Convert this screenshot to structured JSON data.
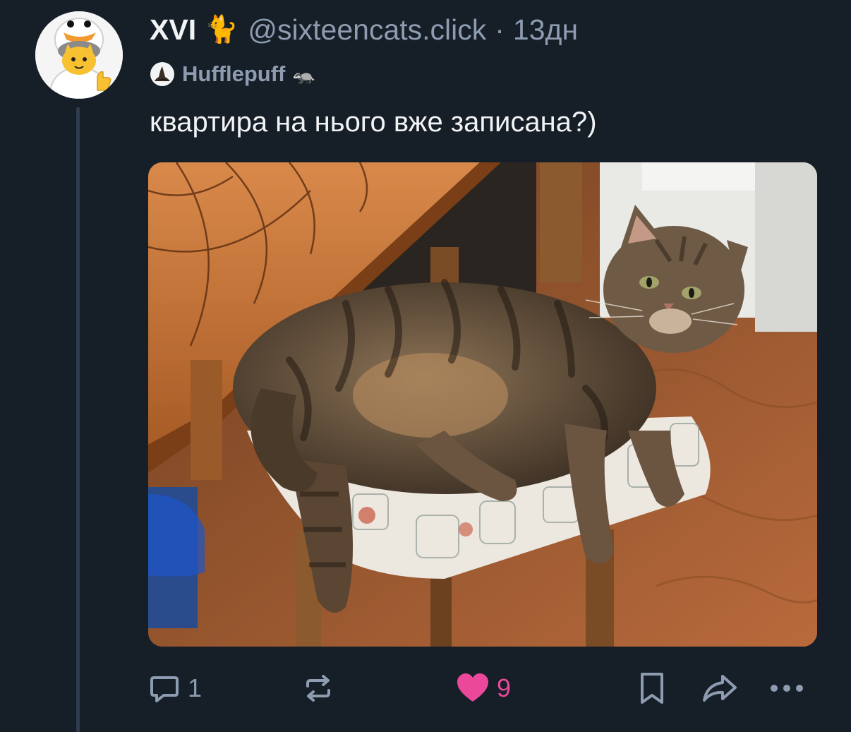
{
  "post": {
    "author": {
      "display_name": "XVI",
      "name_emoji": "🐈",
      "handle": "@sixteencats.click",
      "avatar_icon": "duck-hat-cat-avatar"
    },
    "separator": "·",
    "timestamp": "13дн",
    "label": {
      "icon": "sorting-hat-icon",
      "text": "Hufflepuff",
      "emoji": "🦡"
    },
    "text": "квартира на нього вже записана?)",
    "image": {
      "description_icon": "tabby-cat-on-chair-photo"
    },
    "actions": {
      "reply_count": "1",
      "repost_count": "",
      "like_count": "9",
      "liked": true
    }
  },
  "colors": {
    "background": "#161e27",
    "text_primary": "#f1f3f5",
    "text_secondary": "#8d9cb0",
    "like": "#ec4899",
    "thread_line": "#2e3c4e"
  }
}
